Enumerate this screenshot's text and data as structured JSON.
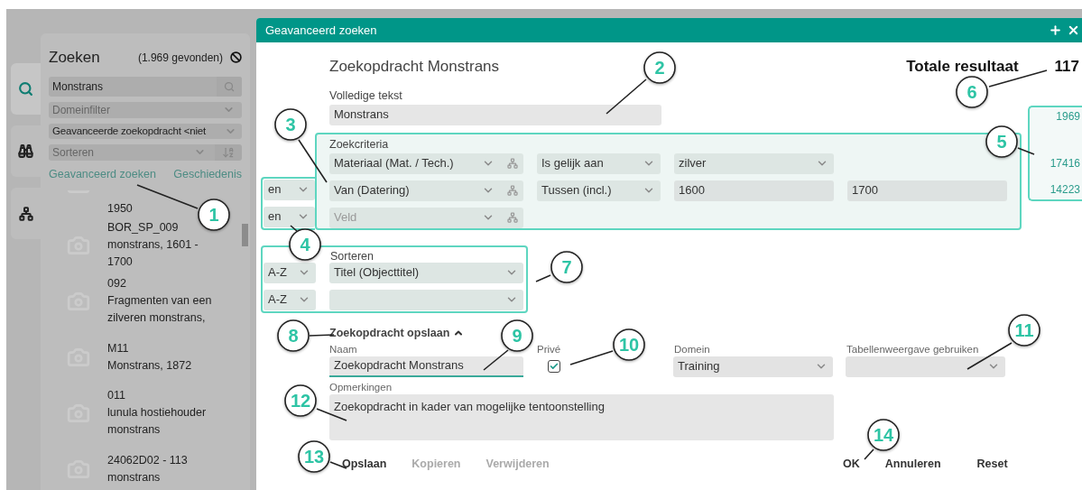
{
  "sidebar": {
    "tabs": [
      {
        "kind": "search",
        "selected": true
      },
      {
        "kind": "binoculars",
        "selected": false
      },
      {
        "kind": "hierarchy",
        "selected": false
      }
    ]
  },
  "search_panel": {
    "title": "Zoeken",
    "count": "(1.969 gevonden)",
    "search_value": "Monstrans",
    "domain_placeholder": "Domeinfilter",
    "advanced_query": "Geavanceerde zoekopdracht <niet",
    "sort_placeholder": "Sorteren",
    "links": [
      "Geavanceerd zoeken",
      "Geschiedenis"
    ],
    "results": [
      {
        "lines": [
          "1950"
        ]
      },
      {
        "lines": [
          "BOR_SP_009",
          "monstrans, 1601 -",
          "1700"
        ]
      },
      {
        "lines": [
          "092",
          "Fragmenten van een",
          "zilveren monstrans,"
        ]
      },
      {
        "lines": [
          "M11",
          "Monstrans, 1872"
        ]
      },
      {
        "lines": [
          "011",
          "lunula hostiehouder",
          "monstrans"
        ]
      },
      {
        "lines": [
          "24062D02 - 113",
          "monstrans"
        ]
      }
    ]
  },
  "dialog": {
    "title": "Geavanceerd zoeken",
    "query_title": "Zoekopdracht Monstrans",
    "total_label": "Totale resultaat",
    "total_value": "117",
    "fulltext": {
      "label": "Volledige tekst",
      "value": "Monstrans"
    },
    "criteria": {
      "label": "Zoekcriteria",
      "connectors": [
        "en",
        "en"
      ],
      "rows": [
        {
          "field": "Materiaal (Mat. / Tech.)",
          "operator": "Is gelijk aan",
          "values": [
            {
              "kind": "select",
              "text": "zilver"
            }
          ]
        },
        {
          "field": "Van (Datering)",
          "operator": "Tussen (incl.)",
          "values": [
            {
              "kind": "text",
              "text": "1600"
            },
            {
              "kind": "text",
              "text": "1700"
            }
          ]
        },
        {
          "field_placeholder": "Veld"
        }
      ],
      "row_results": [
        "1969",
        "17416",
        "14223"
      ]
    },
    "sort": {
      "label": "Sorteren",
      "rows": [
        {
          "order": "A-Z",
          "field": "Titel (Objecttitel)"
        },
        {
          "order": "A-Z"
        }
      ]
    },
    "save": {
      "title": "Zoekopdracht opslaan",
      "expanded": true,
      "name": {
        "label": "Naam",
        "value": "Zoekopdracht Monstrans"
      },
      "private": {
        "label": "Privé",
        "checked": true
      },
      "domain": {
        "label": "Domein",
        "value": "Training"
      },
      "table_view": {
        "label": "Tabellenweergave gebruiken"
      },
      "remarks": {
        "label": "Opmerkingen",
        "value": "Zoekopdracht in kader van mogelijke tentoonstelling"
      }
    },
    "left_buttons": [
      {
        "label": "Opslaan",
        "disabled": false
      },
      {
        "label": "Kopieren",
        "disabled": true
      },
      {
        "label": "Verwijderen",
        "disabled": true
      }
    ],
    "right_buttons": [
      {
        "label": "OK",
        "disabled": false
      },
      {
        "label": "Annuleren",
        "disabled": false
      },
      {
        "label": "Reset",
        "disabled": false
      }
    ]
  },
  "callouts": [
    "1",
    "2",
    "3",
    "4",
    "5",
    "6",
    "7",
    "8",
    "9",
    "10",
    "11",
    "12",
    "13",
    "14"
  ]
}
